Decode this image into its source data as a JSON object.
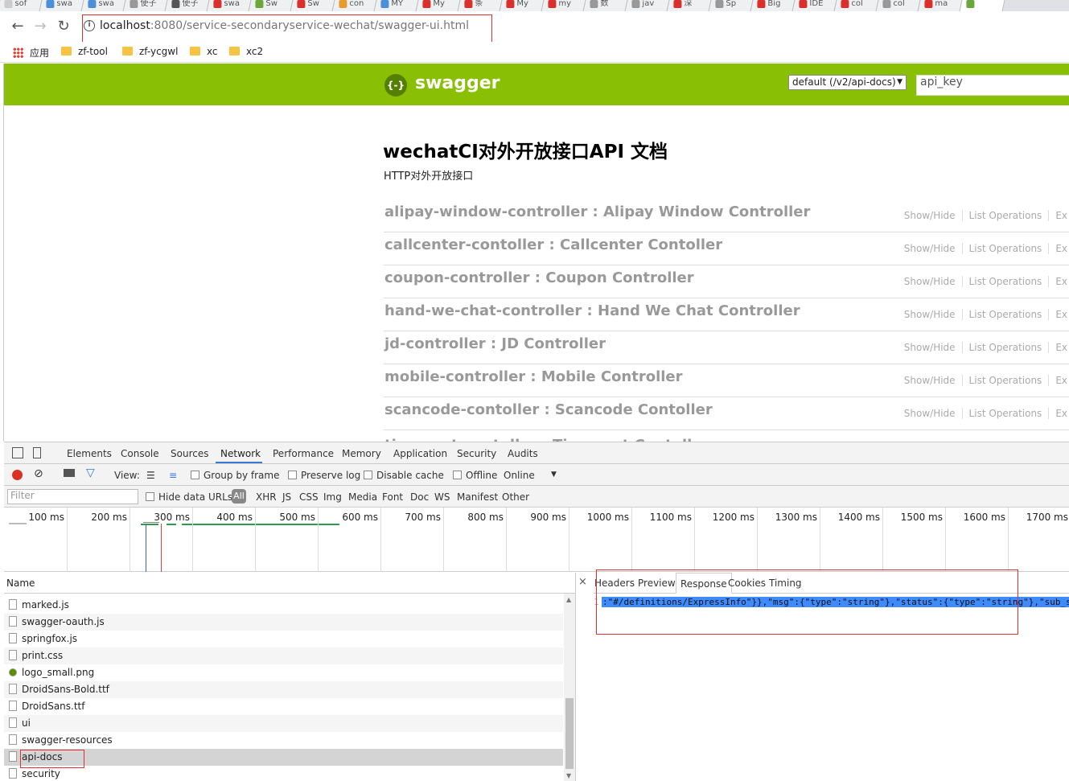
{
  "browser": {
    "tabs": [
      {
        "label": "sof",
        "color": "#cccccc"
      },
      {
        "label": "swa",
        "color": "#4a90d9"
      },
      {
        "label": "swa",
        "color": "#4a90d9"
      },
      {
        "label": "使子",
        "color": "#999999"
      },
      {
        "label": "使子",
        "color": "#555555"
      },
      {
        "label": "swa",
        "color": "#d9302c"
      },
      {
        "label": "Sw",
        "color": "#6aa83b"
      },
      {
        "label": "Sw",
        "color": "#d9302c"
      },
      {
        "label": "con",
        "color": "#e89c2f"
      },
      {
        "label": "MY",
        "color": "#4a90d9"
      },
      {
        "label": "My",
        "color": "#d9302c"
      },
      {
        "label": "条",
        "color": "#d9302c"
      },
      {
        "label": "My",
        "color": "#d9302c"
      },
      {
        "label": "my",
        "color": "#d9302c"
      },
      {
        "label": "数",
        "color": "#999999"
      },
      {
        "label": "jav",
        "color": "#999999"
      },
      {
        "label": "深",
        "color": "#d9302c"
      },
      {
        "label": "Sp",
        "color": "#999999"
      },
      {
        "label": "Big",
        "color": "#d9302c"
      },
      {
        "label": "IDE",
        "color": "#d9302c"
      },
      {
        "label": "col",
        "color": "#d9302c"
      },
      {
        "label": "col",
        "color": "#999999"
      },
      {
        "label": "ma",
        "color": "#d9302c"
      },
      {
        "label": "",
        "color": "#6aa83b"
      }
    ],
    "nav": {
      "back": "←",
      "forward": "→",
      "reload": "↻"
    },
    "url": {
      "host": "localhost",
      "rest": ":8080/service-secondaryservice-wechat/swagger-ui.html"
    },
    "bookmarks": [
      {
        "label": "应用",
        "icon": "apps-icon"
      },
      {
        "label": "zf-tool",
        "icon": "folder-icon"
      },
      {
        "label": "zf-ycgwl",
        "icon": "folder-icon"
      },
      {
        "label": "xc",
        "icon": "folder-icon"
      },
      {
        "label": "xc2",
        "icon": "folder-icon"
      }
    ]
  },
  "swagger": {
    "logo_glyph": "{-}",
    "logo_text": "swagger",
    "spec_select": "default (/v2/api-docs)",
    "api_key_placeholder": "api_key",
    "title": "wechatCI对外开放接口API 文档",
    "description": "HTTP对外开放接口",
    "ops_labels": {
      "show_hide": "Show/Hide",
      "list_operations": "List Operations",
      "expand": "Ex"
    },
    "resources": [
      "alipay-window-controller : Alipay Window Controller",
      "callcenter-contoller : Callcenter Contoller",
      "coupon-controller : Coupon Controller",
      "hand-we-chat-controller : Hand We Chat Controller",
      "jd-controller : JD Controller",
      "mobile-controller : Mobile Controller",
      "scancode-contoller : Scancode Contoller",
      "tianmaot-contoller : Tianmaot Contoller"
    ]
  },
  "devtools": {
    "tabs": [
      "Elements",
      "Console",
      "Sources",
      "Network",
      "Performance",
      "Memory",
      "Application",
      "Security",
      "Audits"
    ],
    "active_tab": "Network",
    "toolbar": {
      "view_label": "View:",
      "group_by_frame": "Group by frame",
      "preserve_log": "Preserve log",
      "disable_cache": "Disable cache",
      "offline": "Offline",
      "online": "Online"
    },
    "filter": {
      "placeholder": "Filter",
      "hide_data_urls": "Hide data URLs",
      "types": [
        "All",
        "XHR",
        "JS",
        "CSS",
        "Img",
        "Media",
        "Font",
        "Doc",
        "WS",
        "Manifest",
        "Other"
      ]
    },
    "timeline_ticks": [
      "100 ms",
      "200 ms",
      "300 ms",
      "400 ms",
      "500 ms",
      "600 ms",
      "700 ms",
      "800 ms",
      "900 ms",
      "1000 ms",
      "1100 ms",
      "1200 ms",
      "1300 ms",
      "1400 ms",
      "1500 ms",
      "1600 ms",
      "1700 ms"
    ],
    "name_header": "Name",
    "requests": [
      {
        "name": "marked.js",
        "icon": "file"
      },
      {
        "name": "swagger-oauth.js",
        "icon": "file"
      },
      {
        "name": "springfox.js",
        "icon": "file"
      },
      {
        "name": "print.css",
        "icon": "file"
      },
      {
        "name": "logo_small.png",
        "icon": "image"
      },
      {
        "name": "DroidSans-Bold.ttf",
        "icon": "file"
      },
      {
        "name": "DroidSans.ttf",
        "icon": "file"
      },
      {
        "name": "ui",
        "icon": "file"
      },
      {
        "name": "swagger-resources",
        "icon": "file"
      },
      {
        "name": "api-docs",
        "icon": "file"
      },
      {
        "name": "security",
        "icon": "file"
      }
    ],
    "selected_request": "api-docs",
    "close_glyph": "×",
    "detail_tabs": [
      "Headers",
      "Preview",
      "Response",
      "Cookies",
      "Timing"
    ],
    "active_detail_tab": "Response",
    "response": {
      "line_number": "1",
      "text": ":\"#/definitions/ExpressInfo\"}},\"msg\":{\"type\":\"string\"},\"status\":{\"type\":\"string\"},\"sub_s"
    }
  }
}
